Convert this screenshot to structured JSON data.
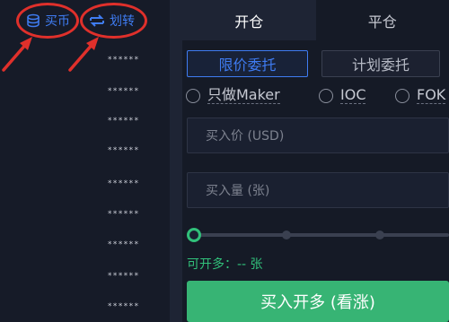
{
  "header": {
    "buy_coin_label": "买币",
    "transfer_label": "划转"
  },
  "orderbook": {
    "masked_rows": [
      "******",
      "******",
      "******",
      "******",
      "******",
      "******",
      "******",
      "******",
      "******",
      "******",
      "******",
      "******",
      "******"
    ]
  },
  "tabs": [
    {
      "label": "开仓",
      "active": true
    },
    {
      "label": "平仓",
      "active": false
    }
  ],
  "order_types": {
    "limit": "限价委托",
    "plan": "计划委托"
  },
  "options": {
    "maker_only": "只做Maker",
    "ioc": "IOC",
    "fok": "FOK"
  },
  "inputs": {
    "price_placeholder": "买入价 (USD)",
    "amount_placeholder": "买入量 (张)"
  },
  "slider": {
    "value_fraction": 0
  },
  "available": "可开多：-- 张",
  "submit_label": "买入开多 (看涨)",
  "colors": {
    "accent_blue": "#3f7cf2",
    "buy_green": "#37b474",
    "annotation_red": "#e0302b"
  }
}
